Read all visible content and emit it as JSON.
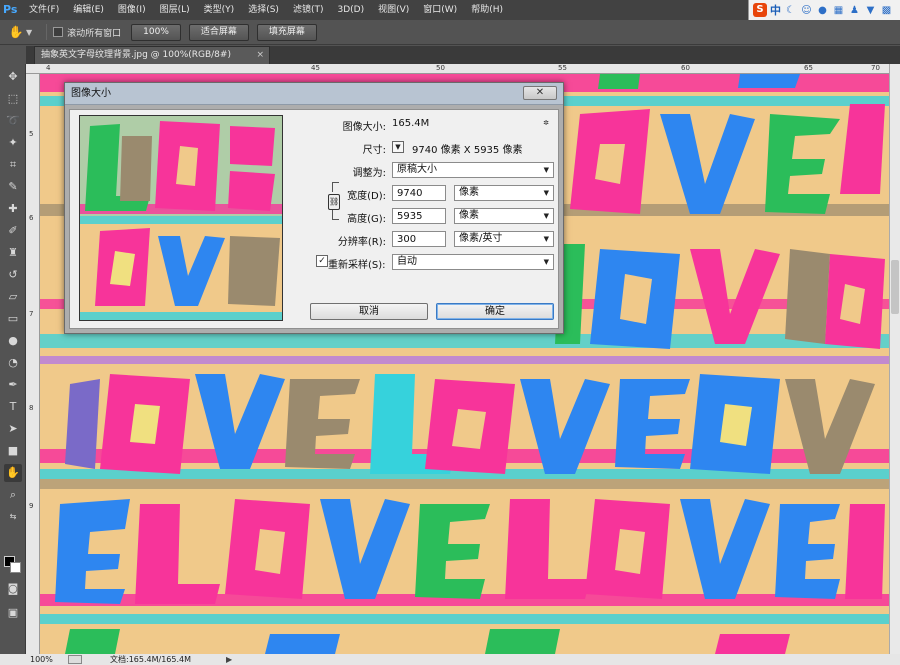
{
  "app": {
    "logo": "Ps"
  },
  "menu": [
    "文件(F)",
    "编辑(E)",
    "图像(I)",
    "图层(L)",
    "类型(Y)",
    "选择(S)",
    "滤镜(T)",
    "3D(D)",
    "视图(V)",
    "窗口(W)",
    "帮助(H)"
  ],
  "ime": {
    "brand": "S",
    "mode": "中",
    "icons": [
      "moon-icon",
      "smile-icon",
      "mic-icon",
      "keyboard-icon",
      "user-icon",
      "shirt-icon",
      "grid-icon"
    ]
  },
  "options": {
    "scroll_all_label": "滚动所有窗口",
    "zoom_100": "100%",
    "fit_screen": "适合屏幕",
    "fill_screen": "填充屏幕"
  },
  "document": {
    "tab_title": "抽象英文字母纹理背景.jpg @ 100%(RGB/8#)",
    "close_glyph": "×"
  },
  "ruler": {
    "h_labels": [
      "4",
      "45",
      "50",
      "55",
      "60",
      "65",
      "70"
    ],
    "v_labels": [
      "5",
      "6",
      "7",
      "8",
      "9"
    ]
  },
  "status": {
    "zoom": "100%",
    "doc_info": "文档:165.4M/165.4M"
  },
  "dialog": {
    "title": "图像大小",
    "close_glyph": "✕",
    "image_size_label": "图像大小:",
    "image_size_value": "165.4M",
    "dimensions_label": "尺寸:",
    "dimensions_value": "9740 像素  X  5935 像素",
    "fit_to_label": "调整为:",
    "fit_to_value": "原稿大小",
    "width_label": "宽度(D):",
    "width_value": "9740",
    "width_unit": "像素",
    "height_label": "高度(G):",
    "height_value": "5935",
    "height_unit": "像素",
    "resolution_label": "分辨率(R):",
    "resolution_value": "300",
    "resolution_unit": "像素/英寸",
    "resample_label": "重新采样(S):",
    "resample_value": "自动",
    "resample_checked": true,
    "cancel_label": "取消",
    "ok_label": "确定"
  },
  "colors": {
    "accent": "#3a7ac4",
    "canvas_bg": "#f0c98a"
  }
}
